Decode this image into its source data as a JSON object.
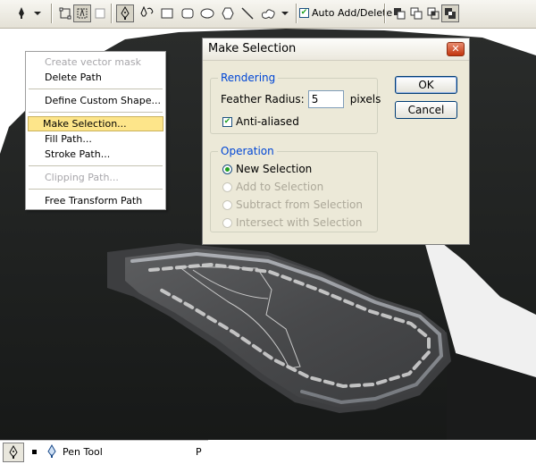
{
  "toolbar": {
    "auto_add_delete_label": "Auto Add/Delete",
    "auto_add_delete_checked": true,
    "icons": [
      "pen-preset-icon",
      "shape-layers-icon",
      "paths-icon",
      "fill-pixels-icon",
      "pen-icon",
      "freeform-pen-icon",
      "rectangle-icon",
      "rounded-rectangle-icon",
      "ellipse-icon",
      "polygon-icon",
      "line-icon",
      "custom-shape-icon",
      "add-to-path-icon",
      "subtract-from-path-icon",
      "intersect-path-icon",
      "exclude-overlap-icon"
    ]
  },
  "context_menu": {
    "items": [
      {
        "label": "Create vector mask",
        "disabled": true
      },
      {
        "label": "Delete Path"
      },
      {
        "label": "Define Custom Shape..."
      },
      {
        "label": "Make Selection...",
        "highlighted": true
      },
      {
        "label": "Fill Path..."
      },
      {
        "label": "Stroke Path..."
      },
      {
        "label": "Clipping Path...",
        "disabled": true
      },
      {
        "label": "Free Transform Path"
      }
    ]
  },
  "dialog": {
    "title": "Make Selection",
    "rendering": {
      "legend": "Rendering",
      "feather_label": "Feather Radius:",
      "feather_value": "5",
      "feather_unit": "pixels",
      "antialiased_label": "Anti-aliased",
      "antialiased_checked": true
    },
    "operation": {
      "legend": "Operation",
      "options": [
        {
          "label": "New Selection",
          "selected": true
        },
        {
          "label": "Add to Selection",
          "disabled": true
        },
        {
          "label": "Subtract from Selection",
          "disabled": true
        },
        {
          "label": "Intersect with Selection",
          "disabled": true
        }
      ]
    },
    "ok_label": "OK",
    "cancel_label": "Cancel"
  },
  "status_bar": {
    "tool_name": "Pen Tool",
    "shortcut": "P"
  },
  "colors": {
    "highlight": "#fde58a",
    "dialog_bg": "#ece9d8",
    "group_legend": "#0046d5",
    "canvas_dark": "#1d1f1e",
    "canvas_gray": "#4f5051"
  }
}
